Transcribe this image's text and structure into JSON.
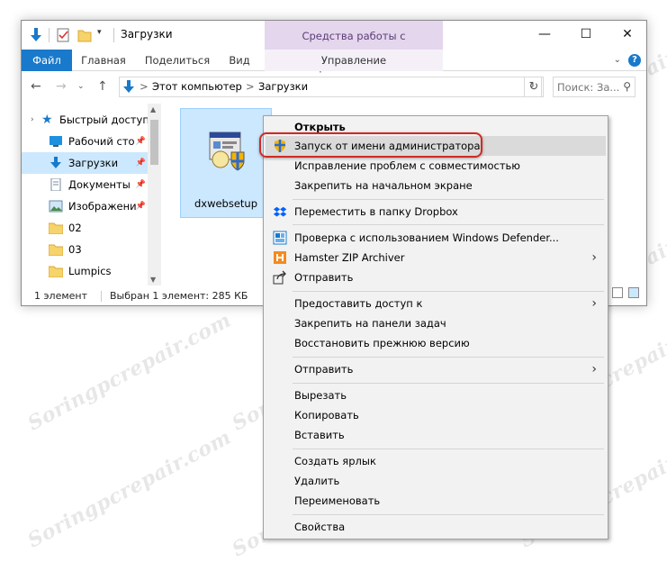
{
  "window": {
    "title": "Загрузки",
    "contextual_tab_group": "Средства работы с приложениями",
    "ribbon_tabs": [
      "Файл",
      "Главная",
      "Поделиться",
      "Вид",
      "Управление"
    ],
    "address": {
      "root": "Этот компьютер",
      "separator": ">",
      "current": "Загрузки"
    },
    "search_placeholder": "Поиск: За...",
    "nav_items": [
      {
        "label": "Быстрый доступ",
        "icon": "star-icon"
      },
      {
        "label": "Рабочий сто",
        "icon": "desktop-icon"
      },
      {
        "label": "Загрузки",
        "icon": "download-arrow-icon",
        "selected": true
      },
      {
        "label": "Документы",
        "icon": "documents-icon"
      },
      {
        "label": "Изображени",
        "icon": "pictures-icon"
      },
      {
        "label": "02",
        "icon": "folder-icon"
      },
      {
        "label": "03",
        "icon": "folder-icon"
      },
      {
        "label": "Lumpics",
        "icon": "folder-icon"
      }
    ],
    "file": {
      "name": "dxwebsetup",
      "icon": "installer-shield-icon"
    },
    "status": {
      "count": "1 элемент",
      "selection": "Выбран 1 элемент: 285 КБ"
    }
  },
  "context_menu": {
    "items": [
      {
        "label": "Открыть"
      },
      {
        "label": "Запуск от имени администратора",
        "icon": "uac-shield-icon",
        "highlighted": true
      },
      {
        "label": "Исправление проблем с совместимостью"
      },
      {
        "label": "Закрепить на начальном экране"
      },
      {
        "label": "Переместить в папку Dropbox",
        "icon": "dropbox-icon"
      },
      {
        "label": "Проверка с использованием Windows Defender...",
        "icon": "defender-icon"
      },
      {
        "label": "Hamster ZIP Archiver",
        "icon": "hamster-icon",
        "submenu": true
      },
      {
        "label": "Отправить",
        "icon": "share-icon"
      },
      {
        "label": "Предоставить доступ к",
        "submenu": true
      },
      {
        "label": "Закрепить на панели задач"
      },
      {
        "label": "Восстановить прежнюю версию"
      },
      {
        "label": "Отправить",
        "submenu": true
      },
      {
        "label": "Вырезать"
      },
      {
        "label": "Копировать"
      },
      {
        "label": "Вставить"
      },
      {
        "label": "Создать ярлык"
      },
      {
        "label": "Удалить"
      },
      {
        "label": "Переименовать"
      },
      {
        "label": "Свойства"
      }
    ]
  },
  "watermark": "Soringpcrepair.com",
  "colors": {
    "accent": "#1979ca",
    "selection": "#cce8ff",
    "highlight_frame": "#d12a22",
    "contextual": "#e4d6ec"
  }
}
